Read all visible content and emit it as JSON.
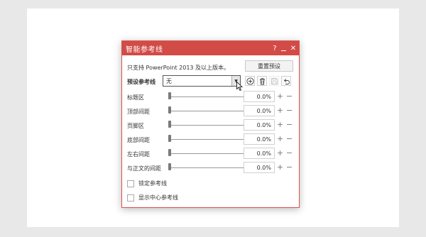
{
  "dialog": {
    "title": "智能参考线",
    "help_label": "?",
    "close_label": "✕"
  },
  "notice": "只支持 PowerPoint 2013 及以上版本。",
  "reset_label": "重置预设",
  "preset": {
    "label": "预设参考线",
    "value": "无"
  },
  "icons": {
    "add": "add-circle-icon",
    "delete": "trash-icon",
    "save": "save-icon",
    "undo": "undo-icon"
  },
  "rows": [
    {
      "label": "标题区",
      "value": "0.0%"
    },
    {
      "label": "顶部间距",
      "value": "0.0%"
    },
    {
      "label": "页脚区",
      "value": "0.0%"
    },
    {
      "label": "底部间距",
      "value": "0.0%"
    },
    {
      "label": "左右间距",
      "value": "0.0%"
    },
    {
      "label": "与正文的间距",
      "value": "0.0%"
    }
  ],
  "slider_levels": [
    0,
    0,
    0,
    0,
    0,
    0
  ],
  "controls": {
    "plus": "+",
    "minus": "−"
  },
  "checkboxes": [
    {
      "label": "锁定参考线",
      "checked": false
    },
    {
      "label": "显示中心参考线",
      "checked": false
    }
  ],
  "colors": {
    "titlebar": "#d24b46",
    "accent": "#d9534f"
  }
}
